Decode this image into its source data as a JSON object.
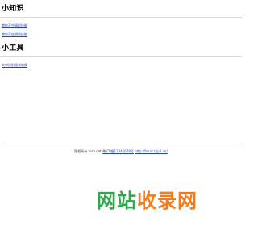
{
  "sections": [
    {
      "title": "小知识",
      "links": [
        "教你开空调的技能",
        "教你开空调的技能"
      ]
    },
    {
      "title": "小工具",
      "links": [
        "文字识别格式转换"
      ]
    }
  ],
  "footer": {
    "dot": ".",
    "copyright_text": "版权所有 fnsa.net",
    "icp_link": "粤ICP备12345678号",
    "url_link": "http://fnsas.top1.cn/"
  },
  "watermark": {
    "part1": "网站",
    "part2": "收录网",
    "colors": {
      "green": "#2ea84a",
      "orange": "#f07d1a"
    }
  },
  "colors": {
    "link": "#2a3fd0",
    "divider": "#d8d8d8"
  }
}
